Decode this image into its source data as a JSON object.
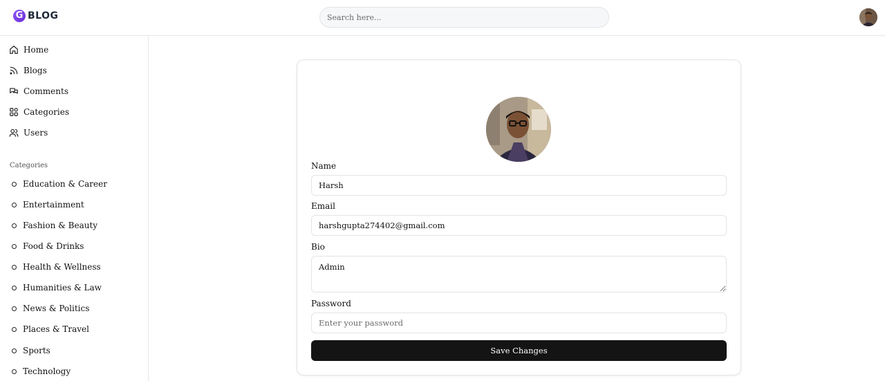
{
  "header": {
    "logo_mark": "G",
    "logo_text": "BLOG",
    "search": {
      "placeholder": "Search here..."
    }
  },
  "sidebar": {
    "nav": [
      {
        "label": "Home",
        "icon": "home-icon"
      },
      {
        "label": "Blogs",
        "icon": "rss-icon"
      },
      {
        "label": "Comments",
        "icon": "comments-icon"
      },
      {
        "label": "Categories",
        "icon": "grid-icon"
      },
      {
        "label": "Users",
        "icon": "users-icon"
      }
    ],
    "categories_title": "Categories",
    "categories": [
      "Education & Career",
      "Entertainment",
      "Fashion & Beauty",
      "Food & Drinks",
      "Health & Wellness",
      "Humanities & Law",
      "News & Politics",
      "Places & Travel",
      "Sports",
      "Technology"
    ]
  },
  "profile_form": {
    "name_label": "Name",
    "name_value": "Harsh",
    "email_label": "Email",
    "email_value": "harshgupta274402@gmail.com",
    "bio_label": "Bio",
    "bio_value": "Admin",
    "password_label": "Password",
    "password_placeholder": "Enter your password",
    "save_label": "Save Changes"
  },
  "colors": {
    "brand_gradient_start": "#8b5cf6",
    "brand_gradient_end": "#6d28d9",
    "button_bg": "#141414",
    "border": "#e2e4e8"
  }
}
